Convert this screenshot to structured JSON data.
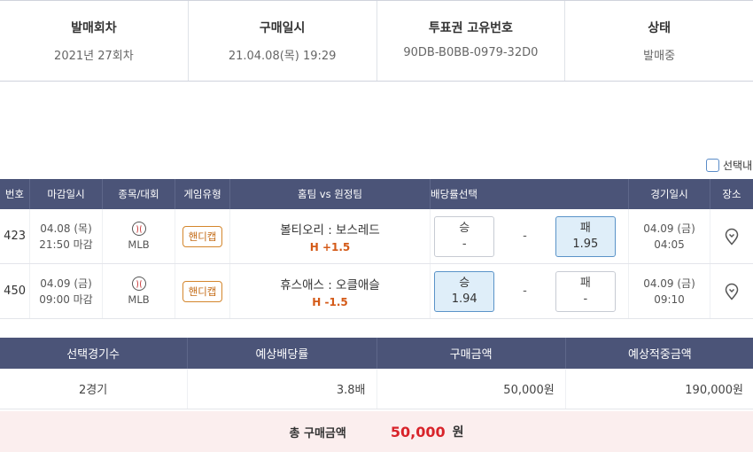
{
  "info": {
    "round": {
      "label": "발매회차",
      "value": "2021년 27회차"
    },
    "date": {
      "label": "구매일시",
      "value": "21.04.08(목) 19:29"
    },
    "ticket": {
      "label": "투표권 고유번호",
      "value": "90DB-B0BB-0979-32D0"
    },
    "status": {
      "label": "상태",
      "value": "발매중"
    }
  },
  "select_all_label": "선택내",
  "games": {
    "headers": [
      "번호",
      "마감일시",
      "종목/대회",
      "게임유형",
      "홈팀 vs 원정팀",
      "배당률선택",
      "경기일시",
      "장소"
    ],
    "rows": [
      {
        "no": "423",
        "deadline_date": "04.08 (목)",
        "deadline_time": "21:50 마감",
        "sport_icon": "baseball-icon",
        "league": "MLB",
        "game_type": "핸디캡",
        "teams": "볼티오리 : 보스레드",
        "handicap": "H +1.5",
        "win": {
          "label": "승",
          "odds": "-",
          "selected": false
        },
        "draw": "-",
        "lose": {
          "label": "패",
          "odds": "1.95",
          "selected": true
        },
        "game_date": "04.09 (금)",
        "game_time": "04:05",
        "place_icon": "location-pin-icon"
      },
      {
        "no": "450",
        "deadline_date": "04.09 (금)",
        "deadline_time": "09:00 마감",
        "sport_icon": "baseball-icon",
        "league": "MLB",
        "game_type": "핸디캡",
        "teams": "휴스애스 : 오클애슬",
        "handicap": "H -1.5",
        "win": {
          "label": "승",
          "odds": "1.94",
          "selected": true
        },
        "draw": "-",
        "lose": {
          "label": "패",
          "odds": "-",
          "selected": false
        },
        "game_date": "04.09 (금)",
        "game_time": "09:10",
        "place_icon": "location-pin-icon"
      }
    ]
  },
  "summary": {
    "headers": [
      "선택경기수",
      "예상배당률",
      "구매금액",
      "예상적중금액"
    ],
    "values": [
      "2경기",
      "3.8배",
      "50,000원",
      "190,000원"
    ]
  },
  "total": {
    "label": "총 구매금액",
    "value": "50,000",
    "unit": "원"
  },
  "colors": {
    "header_bg": "#4b5478",
    "accent_red": "#d8232a",
    "handicap_orange": "#d45a18",
    "selected_bg": "#dfeef9"
  }
}
